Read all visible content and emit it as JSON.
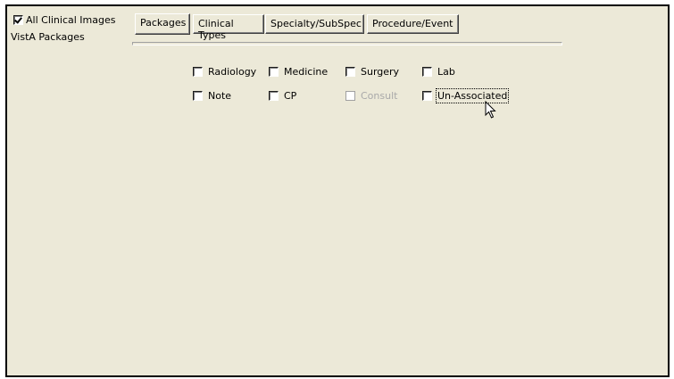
{
  "filter": {
    "all_images_label": "All Clinical Images",
    "all_images_checked": true,
    "section_label": "VistA Packages"
  },
  "tabs": [
    {
      "label": "Packages",
      "selected": true
    },
    {
      "label": "Clinical Types",
      "selected": false
    },
    {
      "label": "Specialty/SubSpec",
      "selected": false
    },
    {
      "label": "Procedure/Event",
      "selected": false
    }
  ],
  "packages": [
    {
      "label": "Radiology",
      "checked": false,
      "enabled": true
    },
    {
      "label": "Medicine",
      "checked": false,
      "enabled": true
    },
    {
      "label": "Surgery",
      "checked": false,
      "enabled": true
    },
    {
      "label": "Lab",
      "checked": false,
      "enabled": true
    },
    {
      "label": "Note",
      "checked": false,
      "enabled": true
    },
    {
      "label": "CP",
      "checked": false,
      "enabled": true
    },
    {
      "label": "Consult",
      "checked": false,
      "enabled": false
    },
    {
      "label": "Un-Associated",
      "checked": false,
      "enabled": true,
      "focused": true
    }
  ],
  "cursor_icon": "arrow-pointer-icon"
}
